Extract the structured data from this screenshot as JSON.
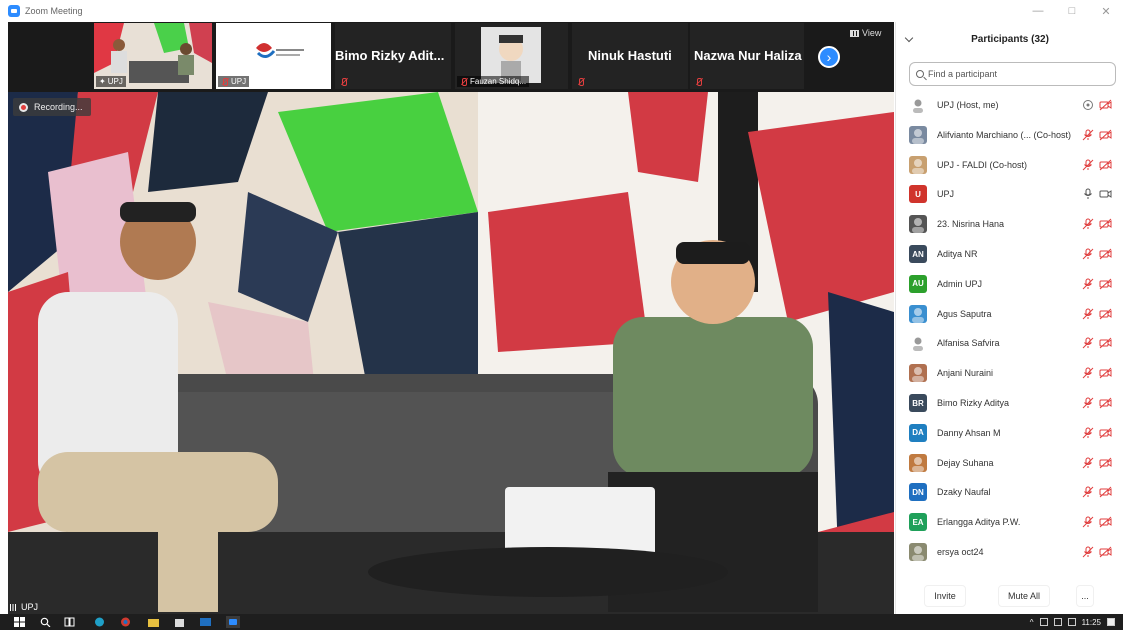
{
  "window": {
    "title": "Zoom Meeting"
  },
  "thumbnails": [
    {
      "label": "UPJ"
    },
    {
      "label": "UPJ"
    },
    {
      "name": "Bimo Rizky Adit..."
    },
    {
      "label": "Fauzan Shidq..."
    },
    {
      "name": "Ninuk Hastuti"
    },
    {
      "name": "Nazwa Nur Haliza"
    }
  ],
  "view_label": "View",
  "recording_label": "Recording...",
  "active_speaker": "UPJ",
  "panel": {
    "title": "Participants (32)",
    "search_placeholder": "Find a participant",
    "participants": [
      {
        "name": "UPJ (Host, me)",
        "initials": "",
        "color": "#ffffff",
        "mic": "unmuted-circle",
        "video": "off"
      },
      {
        "name": "Alifvianto Marchiano (... (Co-host)",
        "initials": "",
        "color": "#7a8aa0",
        "mic": "muted",
        "video": "off"
      },
      {
        "name": "UPJ - FALDI (Co-host)",
        "initials": "",
        "color": "#c8a070",
        "mic": "muted",
        "video": "off"
      },
      {
        "name": "UPJ",
        "initials": "U",
        "color": "#d0342c",
        "mic": "on",
        "video": "on"
      },
      {
        "name": "23. Nisrina Hana",
        "initials": "",
        "color": "#555555",
        "mic": "muted",
        "video": "off"
      },
      {
        "name": "Aditya NR",
        "initials": "AN",
        "color": "#3a4a5c",
        "mic": "muted",
        "video": "off"
      },
      {
        "name": "Admin UPJ",
        "initials": "AU",
        "color": "#2ca02c",
        "mic": "muted",
        "video": "off"
      },
      {
        "name": "Agus Saputra",
        "initials": "",
        "color": "#3a8fd0",
        "mic": "muted",
        "video": "off"
      },
      {
        "name": "Alfanisa Safvira",
        "initials": "",
        "color": "#ffffff",
        "mic": "muted",
        "video": "off"
      },
      {
        "name": "Anjani Nuraini",
        "initials": "",
        "color": "#b07050",
        "mic": "muted",
        "video": "off"
      },
      {
        "name": "Bimo Rizky Aditya",
        "initials": "BR",
        "color": "#3a4a5c",
        "mic": "muted",
        "video": "off"
      },
      {
        "name": "Danny Ahsan M",
        "initials": "DA",
        "color": "#1f7fc0",
        "mic": "muted",
        "video": "off"
      },
      {
        "name": "Dejay Suhana",
        "initials": "",
        "color": "#c07a40",
        "mic": "muted",
        "video": "off"
      },
      {
        "name": "Dzaky Naufal",
        "initials": "DN",
        "color": "#1f6fc0",
        "mic": "muted",
        "video": "off"
      },
      {
        "name": "Erlangga Aditya P.W.",
        "initials": "EA",
        "color": "#1fa05a",
        "mic": "muted",
        "video": "off"
      },
      {
        "name": "ersya oct24",
        "initials": "",
        "color": "#8a8a70",
        "mic": "muted",
        "video": "off"
      }
    ],
    "footer": {
      "invite": "Invite",
      "mute_all": "Mute All",
      "more": "..."
    }
  },
  "taskbar": {
    "time": "11:25"
  }
}
